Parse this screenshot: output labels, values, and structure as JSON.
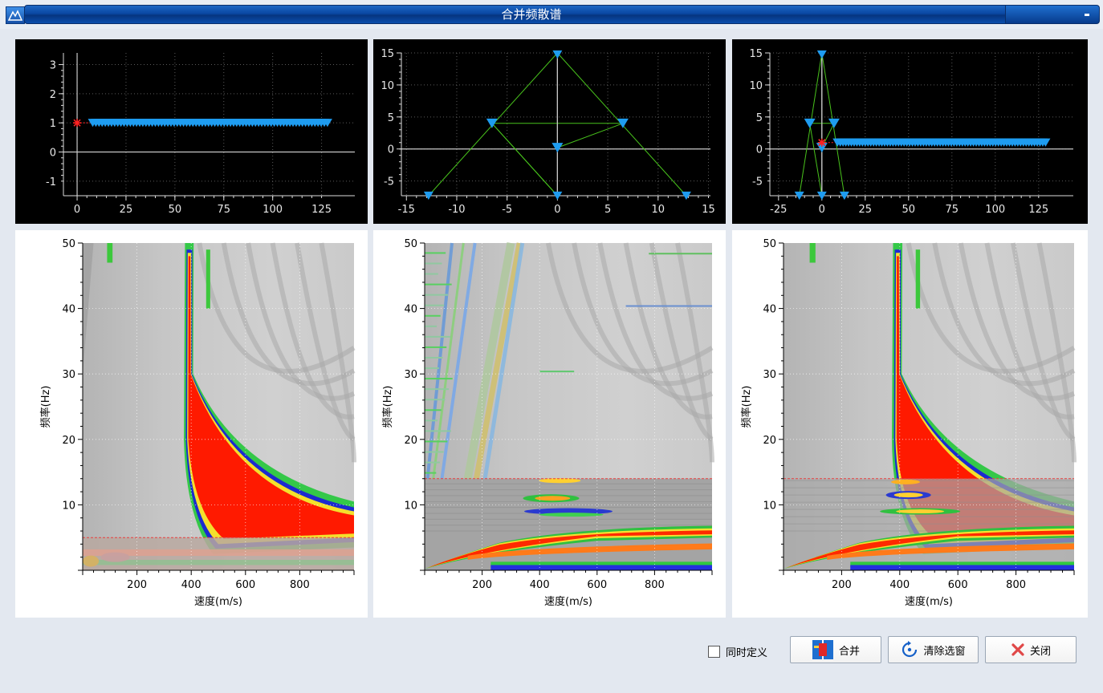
{
  "window": {
    "title": "合并频散谱"
  },
  "colors": {
    "title_bar": "#0a48a3",
    "marker_blue": "#1e9cf0",
    "marker_red": "#ff2020",
    "line_green": "#48c21c",
    "cut_line": "#e84040"
  },
  "top_plots": [
    {
      "x_ticks": [
        "0",
        "25",
        "50",
        "75",
        "100",
        "125"
      ],
      "y_ticks": [
        "3",
        "2",
        "1",
        "0",
        "-1"
      ]
    },
    {
      "x_ticks": [
        "-15",
        "-10",
        "-5",
        "0",
        "5",
        "10",
        "15"
      ],
      "y_ticks": [
        "15",
        "10",
        "5",
        "0",
        "-5"
      ]
    },
    {
      "x_ticks": [
        "-25",
        "0",
        "25",
        "50",
        "75",
        "100",
        "125"
      ],
      "y_ticks": [
        "15",
        "10",
        "5",
        "0",
        "-5"
      ]
    }
  ],
  "spectra": [
    {
      "x_ticks": [
        "200",
        "400",
        "600",
        "800"
      ],
      "y_ticks": [
        "50",
        "40",
        "30",
        "20",
        "10"
      ],
      "xlabel": "速度(m/s)",
      "ylabel": "频率(Hz)",
      "cut_frequency": 5
    },
    {
      "x_ticks": [
        "200",
        "400",
        "600",
        "800"
      ],
      "y_ticks": [
        "50",
        "40",
        "30",
        "20",
        "10"
      ],
      "xlabel": "速度(m/s)",
      "ylabel": "频率(Hz)",
      "cut_frequency": 14
    },
    {
      "x_ticks": [
        "200",
        "400",
        "600",
        "800"
      ],
      "y_ticks": [
        "50",
        "40",
        "30",
        "20",
        "10"
      ],
      "xlabel": "速度(m/s)",
      "ylabel": "频率(Hz)",
      "cut_frequency": 14
    }
  ],
  "controls": {
    "sync_define_label": "同时定义",
    "merge_label": "合并",
    "clear_label": "清除选窗",
    "close_label": "关闭"
  }
}
